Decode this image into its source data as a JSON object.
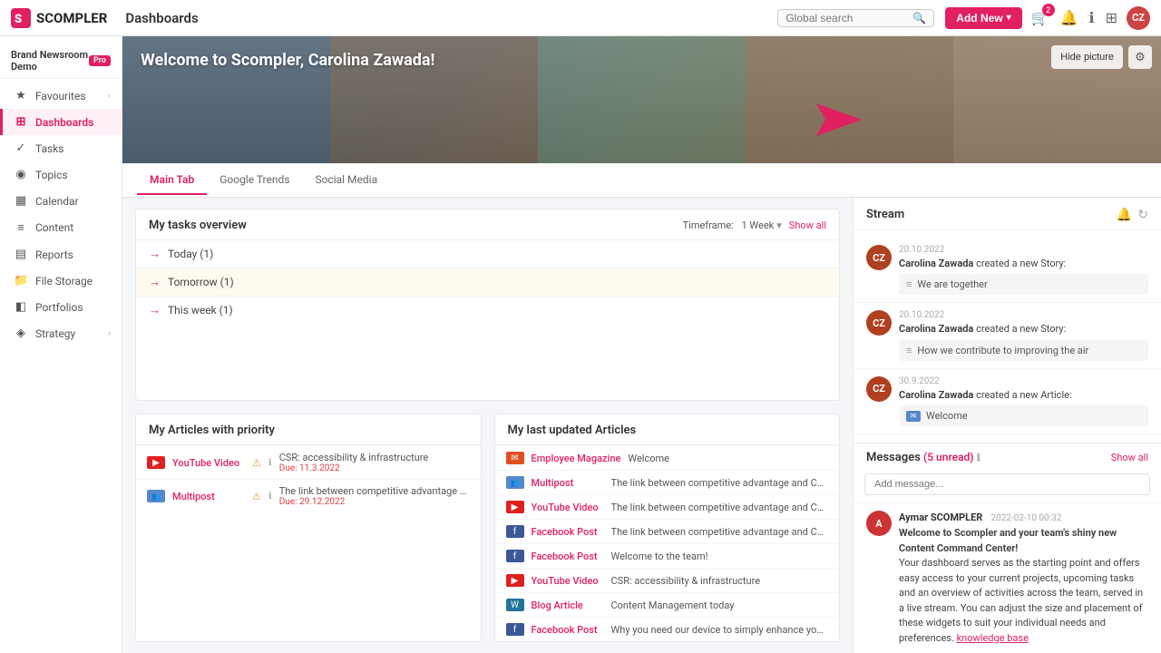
{
  "topnav": {
    "logo_text": "SCOMPLER",
    "title": "Dashboards",
    "search_placeholder": "Global search",
    "btn_addnew": "Add New",
    "notification_badge": "2"
  },
  "workspace": {
    "name": "Brand Newsroom Demo",
    "pro_label": "Pro"
  },
  "sidebar": {
    "items": [
      {
        "id": "favourites",
        "label": "Favourites",
        "icon": "★",
        "has_chevron": true
      },
      {
        "id": "dashboards",
        "label": "Dashboards",
        "icon": "⊞",
        "active": true
      },
      {
        "id": "tasks",
        "label": "Tasks",
        "icon": "✓"
      },
      {
        "id": "topics",
        "label": "Topics",
        "icon": "◉"
      },
      {
        "id": "calendar",
        "label": "Calendar",
        "icon": "▦"
      },
      {
        "id": "content",
        "label": "Content",
        "icon": "≡"
      },
      {
        "id": "reports",
        "label": "Reports",
        "icon": "▤"
      },
      {
        "id": "filestorage",
        "label": "File Storage",
        "icon": "🗁"
      },
      {
        "id": "portfolios",
        "label": "Portfolios",
        "icon": "◧"
      },
      {
        "id": "strategy",
        "label": "Strategy",
        "icon": "◈",
        "has_chevron": true
      }
    ]
  },
  "hero": {
    "welcome_text": "Welcome to Scompler, Carolina Zawada!",
    "hide_picture_btn": "Hide picture"
  },
  "tabs": [
    {
      "id": "main",
      "label": "Main Tab",
      "active": true
    },
    {
      "id": "google",
      "label": "Google Trends"
    },
    {
      "id": "social",
      "label": "Social Media"
    }
  ],
  "tasks_widget": {
    "title": "My tasks overview",
    "timeframe_label": "Timeframe:",
    "timeframe_value": "1 Week",
    "show_all": "Show all",
    "rows": [
      {
        "label": "Today (1)",
        "highlight": false
      },
      {
        "label": "Tomorrow (1)",
        "highlight": true
      },
      {
        "label": "This week (1)",
        "highlight": false
      }
    ]
  },
  "articles_priority": {
    "title": "My Articles with priority",
    "items": [
      {
        "type": "yt",
        "name": "YouTube Video",
        "title": "CSR: accessibility & infrastructure",
        "due_label": "Due: 11.3.2022",
        "warn": true,
        "info": true
      },
      {
        "type": "mp",
        "name": "Multipost",
        "title": "The link between competitive advantage and C...",
        "due_label": "Due: 29.12.2022",
        "warn": true,
        "info": true
      }
    ]
  },
  "articles_updated": {
    "title": "My last updated Articles",
    "items": [
      {
        "type": "em",
        "name": "Employee Magazine",
        "title": "Welcome"
      },
      {
        "type": "mp",
        "name": "Multipost",
        "title": "The link between competitive advantage and CSR"
      },
      {
        "type": "yt",
        "name": "YouTube Video",
        "title": "The link between competitive advantage and CSR"
      },
      {
        "type": "fb",
        "name": "Facebook Post",
        "title": "The link between competitive advantage and CSR"
      },
      {
        "type": "fb",
        "name": "Facebook Post",
        "title": "Welcome to the team!"
      },
      {
        "type": "yt",
        "name": "YouTube Video",
        "title": "CSR: accessibility & infrastructure"
      },
      {
        "type": "wp",
        "name": "Blog Article",
        "title": "Content Management today"
      },
      {
        "type": "fb",
        "name": "Facebook Post",
        "title": "Why you need our device to simply enhance your daily w..."
      }
    ]
  },
  "stream": {
    "title": "Stream",
    "entries": [
      {
        "date": "20.10.2022",
        "author": "Carolina Zawada",
        "action": "created a new Story:",
        "story": "We are together",
        "avatar_color": "#b04020",
        "avatar_initials": "CZ"
      },
      {
        "date": "20.10.2022",
        "author": "Carolina Zawada",
        "action": "created a new Story:",
        "story": "How we contribute to improving the air",
        "avatar_color": "#b04020",
        "avatar_initials": "CZ"
      },
      {
        "date": "30.9.2022",
        "author": "Carolina Zawada",
        "action": "created a new Article:",
        "story": "Welcome",
        "avatar_color": "#b04020",
        "avatar_initials": "CZ"
      }
    ]
  },
  "messages": {
    "title": "Messages",
    "unread_text": "(5 unread)",
    "show_all": "Show all",
    "input_placeholder": "Add message...",
    "entries": [
      {
        "sender": "Aymar SCOMPLER",
        "time": "2022-02-10 00:32",
        "avatar_color": "#cc3333",
        "avatar_initials": "A",
        "text_bold": "Welcome to Scompler and your team's shiny new Content Command Center!",
        "text_body": "Your dashboard serves as the starting point and offers easy access to your current projects, upcoming tasks and an overview of activities across the team, served in a live stream. You can adjust the size and placement of these widgets to suit your individual needs and preferences.",
        "link_text": "knowledge base"
      }
    ]
  }
}
